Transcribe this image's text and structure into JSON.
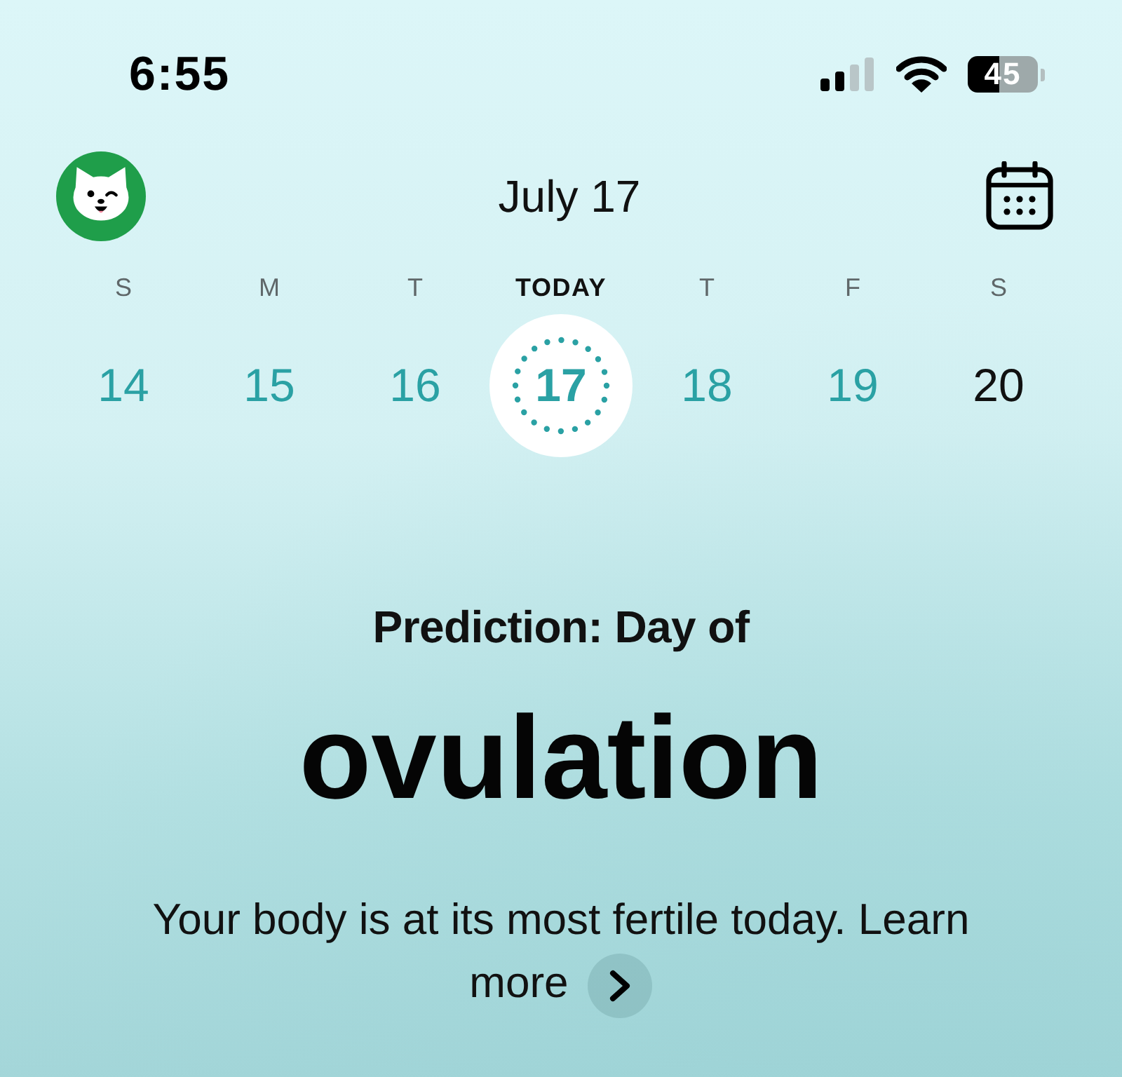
{
  "status_bar": {
    "time": "6:55",
    "battery_percent": "45"
  },
  "header": {
    "title": "July 17"
  },
  "week": [
    {
      "weekday": "S",
      "date": "14",
      "today": false,
      "selected": false,
      "fertile": true,
      "ovulation": false
    },
    {
      "weekday": "M",
      "date": "15",
      "today": false,
      "selected": false,
      "fertile": true,
      "ovulation": false
    },
    {
      "weekday": "T",
      "date": "16",
      "today": false,
      "selected": false,
      "fertile": true,
      "ovulation": false
    },
    {
      "weekday": "TODAY",
      "date": "17",
      "today": true,
      "selected": true,
      "fertile": true,
      "ovulation": true
    },
    {
      "weekday": "T",
      "date": "18",
      "today": false,
      "selected": false,
      "fertile": true,
      "ovulation": false
    },
    {
      "weekday": "F",
      "date": "19",
      "today": false,
      "selected": false,
      "fertile": true,
      "ovulation": false
    },
    {
      "weekday": "S",
      "date": "20",
      "today": false,
      "selected": false,
      "fertile": false,
      "ovulation": false
    }
  ],
  "prediction": {
    "heading": "Prediction: Day of",
    "phase": "ovulation",
    "message": "Your body is at its most fertile today. Learn more"
  }
}
